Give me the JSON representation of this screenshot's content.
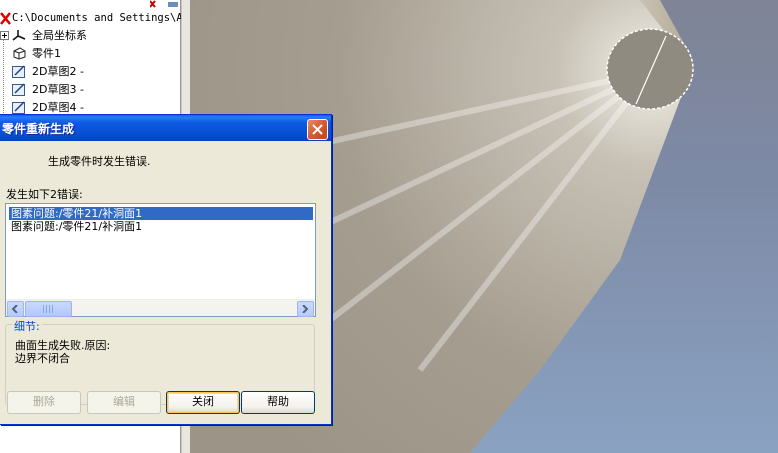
{
  "tree": {
    "path": "C:\\Documents and Settings\\Ac",
    "items": [
      {
        "label": "全局坐标系",
        "icon": "coordinate-system-icon"
      },
      {
        "label": "零件1",
        "icon": "part-icon"
      },
      {
        "label": "2D草图2 -",
        "icon": "sketch-icon"
      },
      {
        "label": "2D草图3 -",
        "icon": "sketch-icon"
      },
      {
        "label": "2D草图4 -",
        "icon": "sketch-icon"
      }
    ]
  },
  "dialog": {
    "title": "零件重新生成",
    "message": "生成零件时发生错误.",
    "list_label": "发生如下2错误:",
    "errors": [
      "图素问题:/零件21/补洞面1",
      "图素问题:/零件21/补洞面1"
    ],
    "details_title": "细节:",
    "details_line1": "曲面生成失败.原因:",
    "details_line2": "边界不闭合",
    "buttons": {
      "delete": "删除",
      "edit": "编辑",
      "close": "关闭",
      "help": "帮助"
    }
  },
  "colors": {
    "title_bar": "#0a4fd6",
    "selection": "#316ac5",
    "close_button": "#d55a30",
    "viewport_bg": "#7d8aa6",
    "surface": "#b9b4ab"
  }
}
